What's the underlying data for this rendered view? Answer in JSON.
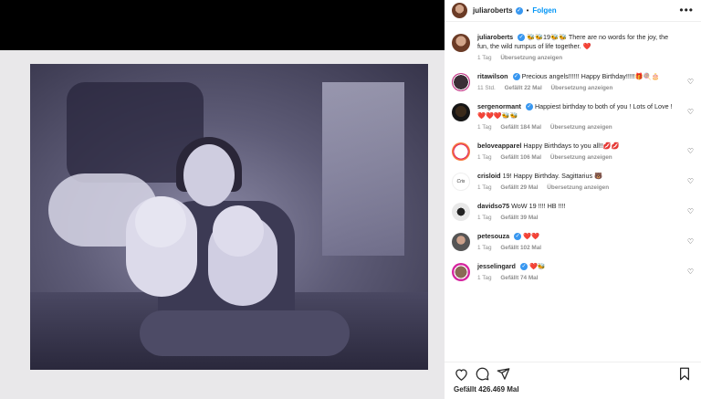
{
  "post": {
    "author": "juliaroberts",
    "follow_label": "Folgen",
    "separator": "•",
    "more_label": "•••",
    "caption": "🐝🐝19🐝🐝 There are no words for the joy, the fun, the wild rumpus of life together. ❤️",
    "caption_time": "1 Tag",
    "caption_translate": "Übersetzung anzeigen",
    "likes": "Gefällt 426.469 Mal"
  },
  "comments": [
    {
      "user": "ritawilson",
      "verified": true,
      "text": "Precious angels!!!!!! Happy Birthday!!!!!🎁🍭🎂",
      "time": "11 Std.",
      "likes": "Gefällt 22 Mal",
      "translate": "Übersetzung anzeigen"
    },
    {
      "user": "sergenormant",
      "verified": true,
      "text": "Happiest birthday to both of you ! Lots of Love ! ❤️❤️❤️🐝🐝",
      "time": "1 Tag",
      "likes": "Gefällt 184 Mal",
      "translate": "Übersetzung anzeigen"
    },
    {
      "user": "beloveapparel",
      "verified": false,
      "text": "Happy Birthdays to you all!!💋💋",
      "time": "1 Tag",
      "likes": "Gefällt 106 Mal",
      "translate": "Übersetzung anzeigen"
    },
    {
      "user": "crisloid",
      "verified": false,
      "text": "19! Happy Birthday. Sagittarius 🐻",
      "time": "1 Tag",
      "likes": "Gefällt 29 Mal",
      "translate": "Übersetzung anzeigen"
    },
    {
      "user": "davidso75",
      "verified": false,
      "text": "WoW 19 !!!! HB !!!!",
      "time": "1 Tag",
      "likes": "Gefällt 39 Mal",
      "translate": ""
    },
    {
      "user": "petesouza",
      "verified": true,
      "text": "❤️❤️",
      "time": "1 Tag",
      "likes": "Gefällt 102 Mal",
      "translate": ""
    },
    {
      "user": "jesselingard",
      "verified": true,
      "text": "❤️🐝",
      "time": "1 Tag",
      "likes": "Gefällt 74 Mal",
      "translate": ""
    }
  ],
  "icons": {
    "like": "heart-icon",
    "comment": "comment-icon",
    "share": "send-icon",
    "save": "bookmark-icon"
  },
  "colors": {
    "accent": "#0095f6",
    "verified": "#3897f0",
    "meta": "#8e8e8e",
    "heart": "#ed4956"
  }
}
